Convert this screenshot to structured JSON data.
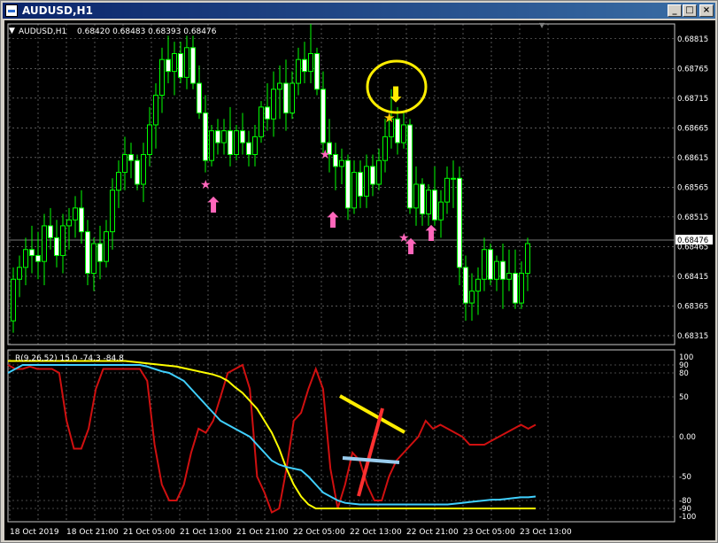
{
  "window": {
    "title": "AUDUSD,H1",
    "buttons": [
      "minimize-icon",
      "restore-icon",
      "close-icon"
    ]
  },
  "colors": {
    "background": "#000000",
    "grid": "#c8c8c8",
    "candle_up": "#00ff00",
    "candle_down_body": "#ffffff",
    "oscillator_red": "#d01010",
    "oscillator_yellow": "#ffff00",
    "oscillator_cyan": "#40d0ff",
    "star_pink": "#ff66bb",
    "arrow_pink": "#ff66bb",
    "star_yellow": "#ffcc00",
    "circle_yellow": "#ffee00",
    "drawn_yellow": "#ffee00",
    "drawn_red": "#ff3030",
    "drawn_blue": "#99ccee"
  },
  "chart_data": [
    {
      "type": "candlestick",
      "title": "AUDUSD,H1",
      "ohlc_label": "0.68420 0.68483 0.68393 0.68476",
      "current_price": "0.68476",
      "ylim": [
        0.683,
        0.6885
      ],
      "y_ticks": [
        "0.68815",
        "0.68765",
        "0.68715",
        "0.68665",
        "0.68615",
        "0.68565",
        "0.68515",
        "0.68465",
        "0.68415",
        "0.68365",
        "0.68315"
      ],
      "x_ticks": [
        "18 Oct 2019",
        "18 Oct 21:00",
        "21 Oct 05:00",
        "21 Oct 13:00",
        "21 Oct 21:00",
        "22 Oct 05:00",
        "22 Oct 13:00",
        "22 Oct 21:00",
        "23 Oct 05:00",
        "23 Oct 13:00"
      ],
      "candles": [
        [
          0.6834,
          0.6843,
          0.6832,
          0.6841
        ],
        [
          0.6841,
          0.6845,
          0.6838,
          0.6843
        ],
        [
          0.6843,
          0.6848,
          0.684,
          0.6846
        ],
        [
          0.6846,
          0.685,
          0.6842,
          0.6845
        ],
        [
          0.6845,
          0.6849,
          0.6841,
          0.6844
        ],
        [
          0.6844,
          0.6852,
          0.684,
          0.685
        ],
        [
          0.685,
          0.6853,
          0.6846,
          0.6848
        ],
        [
          0.6848,
          0.6851,
          0.6843,
          0.6845
        ],
        [
          0.6845,
          0.6852,
          0.6842,
          0.685
        ],
        [
          0.685,
          0.6853,
          0.6846,
          0.6851
        ],
        [
          0.6851,
          0.6855,
          0.6848,
          0.6853
        ],
        [
          0.6853,
          0.6856,
          0.6847,
          0.6849
        ],
        [
          0.6849,
          0.6851,
          0.684,
          0.6842
        ],
        [
          0.6842,
          0.6848,
          0.6839,
          0.6847
        ],
        [
          0.6847,
          0.685,
          0.6841,
          0.6844
        ],
        [
          0.6844,
          0.6851,
          0.6843,
          0.6849
        ],
        [
          0.6849,
          0.6858,
          0.6846,
          0.6856
        ],
        [
          0.6856,
          0.6861,
          0.6853,
          0.6859
        ],
        [
          0.6859,
          0.6865,
          0.6856,
          0.6862
        ],
        [
          0.6862,
          0.6864,
          0.6858,
          0.6861
        ],
        [
          0.6861,
          0.6862,
          0.6856,
          0.6857
        ],
        [
          0.6857,
          0.6864,
          0.6854,
          0.6862
        ],
        [
          0.6862,
          0.687,
          0.686,
          0.6867
        ],
        [
          0.6867,
          0.6874,
          0.6863,
          0.6872
        ],
        [
          0.6872,
          0.688,
          0.6869,
          0.6878
        ],
        [
          0.6878,
          0.6882,
          0.6874,
          0.6876
        ],
        [
          0.6876,
          0.6881,
          0.6872,
          0.6879
        ],
        [
          0.6879,
          0.6881,
          0.6874,
          0.6875
        ],
        [
          0.6875,
          0.6882,
          0.6873,
          0.688
        ],
        [
          0.688,
          0.6882,
          0.6873,
          0.6874
        ],
        [
          0.6874,
          0.6877,
          0.6868,
          0.6869
        ],
        [
          0.6869,
          0.6872,
          0.6859,
          0.6861
        ],
        [
          0.6861,
          0.6867,
          0.686,
          0.6866
        ],
        [
          0.6866,
          0.6868,
          0.6862,
          0.6864
        ],
        [
          0.6864,
          0.6868,
          0.6862,
          0.6866
        ],
        [
          0.6866,
          0.687,
          0.686,
          0.6862
        ],
        [
          0.6862,
          0.6867,
          0.6861,
          0.6866
        ],
        [
          0.6866,
          0.6869,
          0.6862,
          0.6864
        ],
        [
          0.6864,
          0.6866,
          0.686,
          0.6862
        ],
        [
          0.6862,
          0.6867,
          0.686,
          0.6865
        ],
        [
          0.6865,
          0.6871,
          0.6864,
          0.687
        ],
        [
          0.687,
          0.6874,
          0.6866,
          0.6868
        ],
        [
          0.6868,
          0.6876,
          0.6865,
          0.6873
        ],
        [
          0.6873,
          0.6877,
          0.6868,
          0.6874
        ],
        [
          0.6874,
          0.6878,
          0.6866,
          0.6869
        ],
        [
          0.6869,
          0.6876,
          0.6868,
          0.6874
        ],
        [
          0.6874,
          0.688,
          0.6872,
          0.6878
        ],
        [
          0.6878,
          0.6881,
          0.6874,
          0.6876
        ],
        [
          0.6876,
          0.6884,
          0.6874,
          0.6879
        ],
        [
          0.6879,
          0.688,
          0.6872,
          0.6873
        ],
        [
          0.6873,
          0.6876,
          0.6862,
          0.6864
        ],
        [
          0.6864,
          0.6868,
          0.6859,
          0.6862
        ],
        [
          0.6862,
          0.6864,
          0.6856,
          0.686
        ],
        [
          0.686,
          0.6863,
          0.6857,
          0.6861
        ],
        [
          0.6861,
          0.6862,
          0.6851,
          0.6853
        ],
        [
          0.6853,
          0.6861,
          0.6852,
          0.6859
        ],
        [
          0.6859,
          0.6861,
          0.6853,
          0.6855
        ],
        [
          0.6855,
          0.6862,
          0.6853,
          0.686
        ],
        [
          0.686,
          0.6862,
          0.6855,
          0.6857
        ],
        [
          0.6857,
          0.6863,
          0.6856,
          0.6861
        ],
        [
          0.6861,
          0.6868,
          0.6859,
          0.6865
        ],
        [
          0.6865,
          0.6873,
          0.6863,
          0.6868
        ],
        [
          0.6868,
          0.687,
          0.6862,
          0.6864
        ],
        [
          0.6864,
          0.6869,
          0.6863,
          0.6867
        ],
        [
          0.6867,
          0.6868,
          0.6852,
          0.6853
        ],
        [
          0.6853,
          0.686,
          0.685,
          0.6857
        ],
        [
          0.6857,
          0.6858,
          0.685,
          0.6852
        ],
        [
          0.6852,
          0.6857,
          0.685,
          0.6856
        ],
        [
          0.6856,
          0.686,
          0.685,
          0.6851
        ],
        [
          0.6851,
          0.6856,
          0.6848,
          0.6854
        ],
        [
          0.6854,
          0.686,
          0.6852,
          0.6858
        ],
        [
          0.6858,
          0.6861,
          0.6853,
          0.6858
        ],
        [
          0.6858,
          0.686,
          0.684,
          0.6843
        ],
        [
          0.6843,
          0.6845,
          0.6834,
          0.6837
        ],
        [
          0.6837,
          0.6842,
          0.6834,
          0.6839
        ],
        [
          0.6839,
          0.6843,
          0.6835,
          0.6841
        ],
        [
          0.6841,
          0.6848,
          0.6839,
          0.6846
        ],
        [
          0.6846,
          0.6847,
          0.684,
          0.6841
        ],
        [
          0.6841,
          0.6845,
          0.6839,
          0.6844
        ],
        [
          0.6844,
          0.6847,
          0.6836,
          0.6841
        ],
        [
          0.6841,
          0.6846,
          0.6839,
          0.6842
        ],
        [
          0.6842,
          0.6846,
          0.6836,
          0.6837
        ],
        [
          0.6837,
          0.6844,
          0.6836,
          0.6842
        ],
        [
          0.6842,
          0.6848,
          0.6839,
          0.6847
        ]
      ]
    },
    {
      "type": "line",
      "title": "R(9,26,52) 15.0 -74.3 -84.8",
      "ylim": [
        -100,
        100
      ],
      "y_ticks": [
        "100",
        "90",
        "80",
        "50",
        "0.00",
        "-50",
        "-80",
        "-90",
        "-100"
      ],
      "series": [
        {
          "color": "#d01010",
          "values": [
            90,
            85,
            85,
            88,
            85,
            85,
            85,
            80,
            20,
            -15,
            -15,
            10,
            60,
            85,
            85,
            85,
            85,
            85,
            85,
            70,
            -10,
            -60,
            -80,
            -80,
            -60,
            -20,
            10,
            5,
            20,
            50,
            80,
            85,
            90,
            60,
            -50,
            -70,
            -95,
            -90,
            -40,
            20,
            30,
            60,
            85,
            60,
            -40,
            -90,
            -60,
            -20,
            -30,
            -60,
            -80,
            -80,
            -50,
            -30,
            -20,
            -10,
            0,
            20,
            10,
            15,
            10,
            5,
            0,
            -10,
            -10,
            -10,
            -5,
            0,
            5,
            10,
            15,
            10,
            15
          ]
        },
        {
          "color": "#ffff00",
          "values": [
            95,
            95,
            95,
            95,
            95,
            95,
            95,
            95,
            95,
            95,
            95,
            95,
            95,
            95,
            95,
            95,
            95,
            94,
            93,
            92,
            91,
            90,
            89,
            88,
            86,
            84,
            82,
            80,
            78,
            75,
            70,
            62,
            55,
            45,
            35,
            20,
            5,
            -15,
            -40,
            -60,
            -75,
            -85,
            -90,
            -90,
            -90,
            -90,
            -90,
            -90,
            -90,
            -90,
            -90,
            -90,
            -90,
            -90,
            -90,
            -90,
            -90,
            -90,
            -90,
            -90,
            -90,
            -90,
            -90,
            -90,
            -90,
            -90,
            -90,
            -90,
            -90,
            -90,
            -90,
            -90,
            -90
          ]
        },
        {
          "color": "#40d0ff",
          "values": [
            80,
            85,
            90,
            90,
            90,
            90,
            90,
            90,
            90,
            90,
            90,
            90,
            90,
            90,
            90,
            90,
            90,
            90,
            90,
            88,
            85,
            82,
            80,
            75,
            70,
            60,
            50,
            40,
            30,
            20,
            15,
            10,
            5,
            0,
            -10,
            -20,
            -30,
            -35,
            -38,
            -40,
            -42,
            -50,
            -60,
            -70,
            -75,
            -80,
            -83,
            -84,
            -85,
            -85,
            -85,
            -85,
            -85,
            -85,
            -85,
            -85,
            -85,
            -85,
            -85,
            -85,
            -85,
            -84,
            -83,
            -82,
            -81,
            -80,
            -79,
            -79,
            -78,
            -77,
            -76,
            -76,
            -75
          ]
        }
      ]
    }
  ],
  "annotations": {
    "arrow_up": "⬆",
    "arrow_down": "⬇",
    "star": "★"
  }
}
